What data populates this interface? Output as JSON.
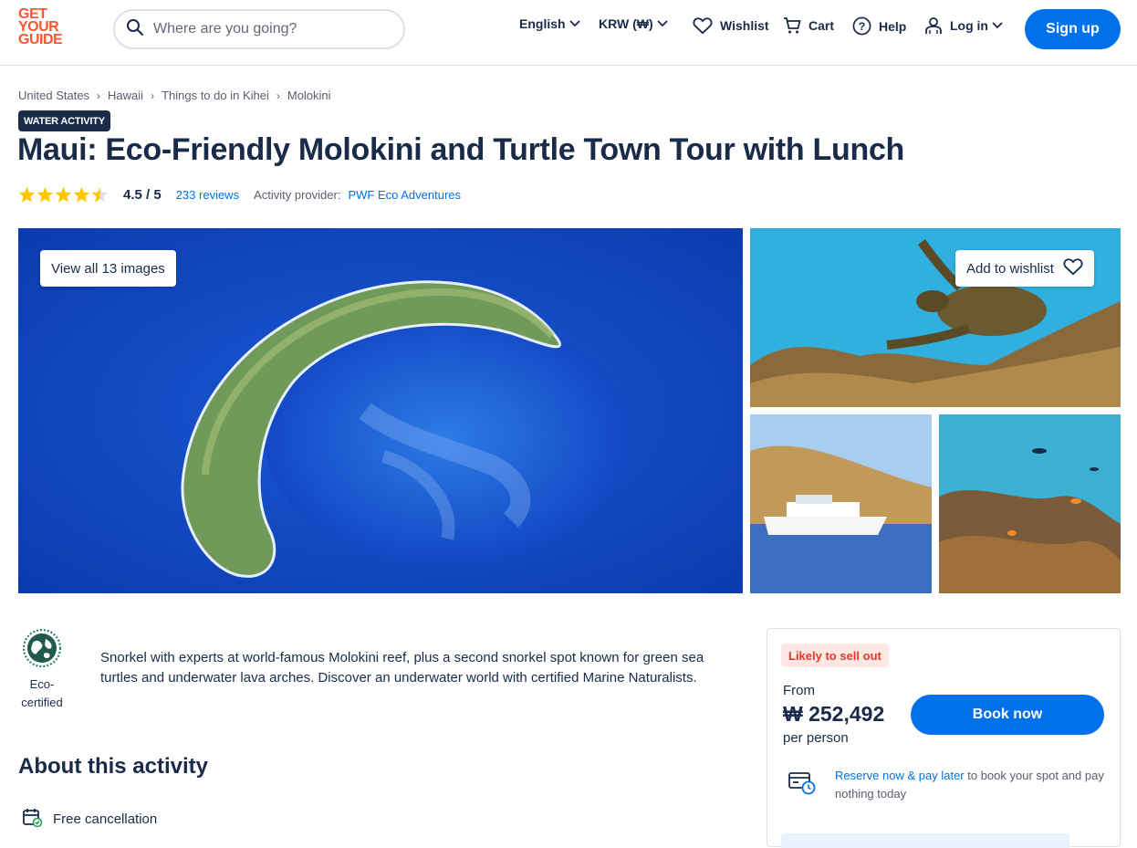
{
  "header": {
    "logo_lines": [
      "GET",
      "YOUR",
      "GUIDE"
    ],
    "search_placeholder": "Where are you going?",
    "language_label": "English",
    "currency_label": "KRW (₩)",
    "wishlist_label": "Wishlist",
    "cart_label": "Cart",
    "help_label": "Help",
    "login_label": "Log in",
    "signup_label": "Sign up"
  },
  "breadcrumb": [
    "United States",
    "Hawaii",
    "Things to do in Kihei",
    "Molokini"
  ],
  "activity": {
    "category_badge": "WATER ACTIVITY",
    "title": "Maui: Eco-Friendly Molokini and Turtle Town Tour with Lunch",
    "rating": 4.5,
    "rating_text": "4.5 / 5",
    "reviews_text": "233 reviews",
    "provider_label": "Activity provider:",
    "provider_name": "PWF Eco Adventures"
  },
  "gallery": {
    "view_all_label": "View all 13 images",
    "add_to_wishlist_label": "Add to wishlist",
    "images": [
      "Molokini crater aerial",
      "Sea turtle over reef",
      "Catamaran near shore",
      "Reef fish underwater"
    ]
  },
  "highlights": {
    "eco_label_lines": [
      "Eco-",
      "certified"
    ],
    "summary": "Snorkel with experts at world-famous Molokini reef, plus a second snorkel spot known for green sea turtles and underwater lava arches. Discover an underwater world with certified Marine Naturalists."
  },
  "about": {
    "heading": "About this activity",
    "items": [
      {
        "label": "Free cancellation",
        "icon": "calendar-check-icon"
      }
    ]
  },
  "booking": {
    "urgency_badge": "Likely to sell out",
    "from_label": "From",
    "price": "₩ 252,492",
    "per_label": "per person",
    "book_button": "Book now",
    "reserve_link": "Reserve now & pay later",
    "reserve_text": " to book your spot and pay nothing today"
  },
  "colors": {
    "brand_orange": "#ff5533",
    "primary_blue": "#0071eb",
    "navy_text": "#1a2b49",
    "star_yellow": "#ffc700",
    "urgency_red": "#e5372b"
  }
}
